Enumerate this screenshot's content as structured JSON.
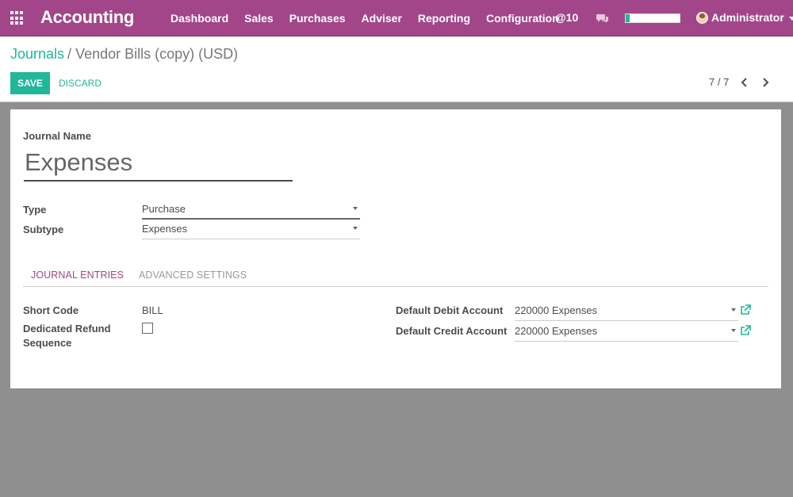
{
  "navbar": {
    "brand": "Accounting",
    "menu": [
      "Dashboard",
      "Sales",
      "Purchases",
      "Adviser",
      "Reporting",
      "Configuration"
    ],
    "mentions": "@10",
    "user_name": "Administrator",
    "progress_fraction": 0.07,
    "accent_color": "#a24689"
  },
  "control_panel": {
    "breadcrumb_parent": "Journals",
    "breadcrumb_separator": "/",
    "breadcrumb_current": "Vendor Bills (copy) (USD)",
    "save_label": "SAVE",
    "discard_label": "DISCARD",
    "pager": "7 / 7"
  },
  "form": {
    "journal_name_label": "Journal Name",
    "journal_name_value": "Expenses",
    "type_label": "Type",
    "type_value": "Purchase",
    "subtype_label": "Subtype",
    "subtype_value": "Expenses",
    "tabs": [
      "JOURNAL ENTRIES",
      "ADVANCED SETTINGS"
    ],
    "active_tab": "JOURNAL ENTRIES",
    "short_code_label": "Short Code",
    "short_code_value": "BILL",
    "refund_label_line1": "Dedicated Refund",
    "refund_label_line2": "Sequence",
    "refund_checked": false,
    "debit_label": "Default Debit Account",
    "debit_value": "220000 Expenses",
    "credit_label": "Default Credit Account",
    "credit_value": "220000 Expenses"
  },
  "colors": {
    "primary": "#21b799",
    "navbar": "#a24689",
    "background": "#8f8f8f"
  }
}
